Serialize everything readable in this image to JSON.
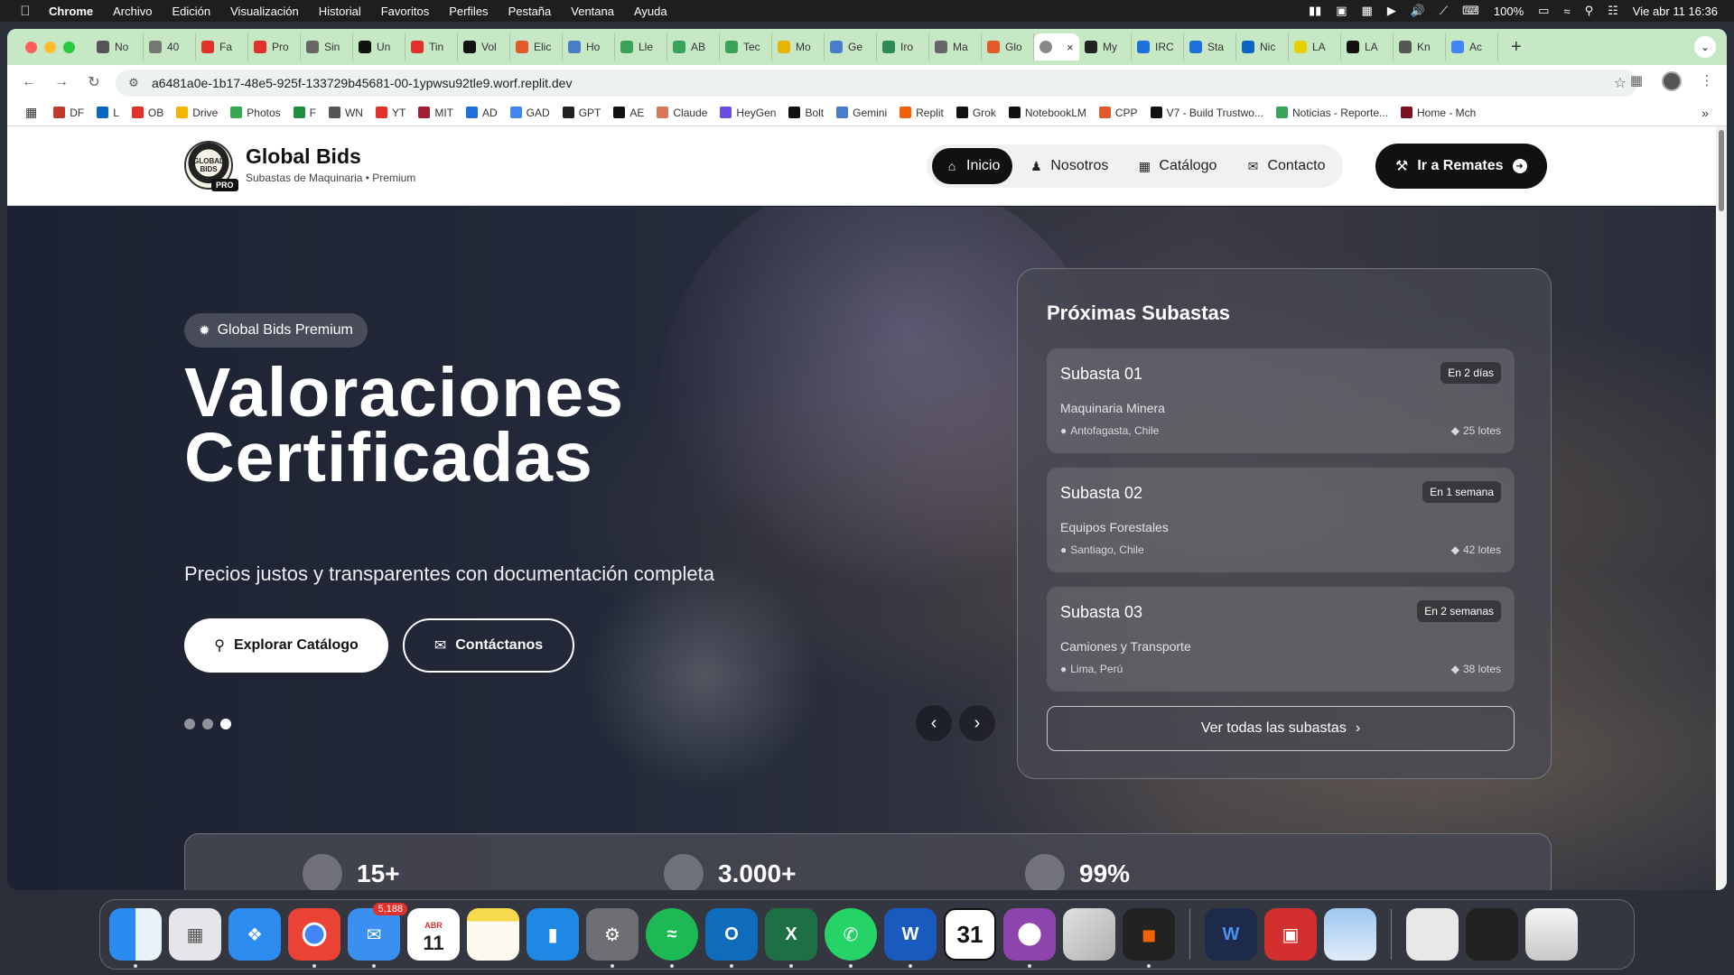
{
  "menubar": {
    "app_name": "Chrome",
    "items": [
      "Archivo",
      "Edición",
      "Visualización",
      "Historial",
      "Favoritos",
      "Perfiles",
      "Pestaña",
      "Ventana",
      "Ayuda"
    ],
    "battery": "100%",
    "datetime": "Vie abr 11  16:36"
  },
  "browser": {
    "tabs": [
      {
        "label": "No",
        "color": "#555"
      },
      {
        "label": "40",
        "color": "#777"
      },
      {
        "label": "Fa",
        "color": "#e0322b"
      },
      {
        "label": "Pro",
        "color": "#e0322b"
      },
      {
        "label": "Sin",
        "color": "#666"
      },
      {
        "label": "Un",
        "color": "#111"
      },
      {
        "label": "Tin",
        "color": "#e0322b"
      },
      {
        "label": "Vol",
        "color": "#111"
      },
      {
        "label": "Elic",
        "color": "#e05a2b"
      },
      {
        "label": "Ho",
        "color": "#4a7dc9"
      },
      {
        "label": "Lle",
        "color": "#3aa35a"
      },
      {
        "label": "AB",
        "color": "#3aa35a"
      },
      {
        "label": "Tec",
        "color": "#3aa35a"
      },
      {
        "label": "Mo",
        "color": "#e6b500"
      },
      {
        "label": "Ge",
        "color": "#4a7dc9"
      },
      {
        "label": "Iro",
        "color": "#2e8b57"
      },
      {
        "label": "Ma",
        "color": "#666"
      },
      {
        "label": "Glo",
        "color": "#e05a2b"
      }
    ],
    "active_tab_close": "×",
    "tabs_after": [
      {
        "label": "My",
        "color": "#222"
      },
      {
        "label": "IRC",
        "color": "#1e6fd9"
      },
      {
        "label": "Sta",
        "color": "#1e6fd9"
      },
      {
        "label": "Nic",
        "color": "#0a66c2"
      },
      {
        "label": "LA",
        "color": "#e6d000"
      },
      {
        "label": "LA",
        "color": "#111"
      },
      {
        "label": "Kn",
        "color": "#555"
      },
      {
        "label": "Ac",
        "color": "#4285f4"
      }
    ],
    "url": "a6481a0e-1b17-48e5-925f-133729b45681-00-1ypwsu92tle9.worf.replit.dev",
    "bookmarks": [
      {
        "label": "DF",
        "color": "#c0392b"
      },
      {
        "label": "L",
        "color": "#0a66c2"
      },
      {
        "label": "OB",
        "color": "#e0322b"
      },
      {
        "label": "Drive",
        "color": "#f4b400"
      },
      {
        "label": "Photos",
        "color": "#34a853"
      },
      {
        "label": "F",
        "color": "#1e8e3e"
      },
      {
        "label": "WN",
        "color": "#555"
      },
      {
        "label": "YT",
        "color": "#e0322b"
      },
      {
        "label": "MIT",
        "color": "#a31f34"
      },
      {
        "label": "AD",
        "color": "#1e6fd9"
      },
      {
        "label": "GAD",
        "color": "#4285f4"
      },
      {
        "label": "GPT",
        "color": "#222"
      },
      {
        "label": "AE",
        "color": "#111"
      },
      {
        "label": "Claude",
        "color": "#d97757"
      },
      {
        "label": "HeyGen",
        "color": "#6b4ce6"
      },
      {
        "label": "Bolt",
        "color": "#111"
      },
      {
        "label": "Gemini",
        "color": "#4a7dc9"
      },
      {
        "label": "Replit",
        "color": "#f26207"
      },
      {
        "label": "Grok",
        "color": "#111"
      },
      {
        "label": "NotebookLM",
        "color": "#111"
      },
      {
        "label": "CPP",
        "color": "#e05a2b"
      },
      {
        "label": "V7 - Build Trustwo...",
        "color": "#111"
      },
      {
        "label": "Noticias - Reporte...",
        "color": "#3aa35a"
      },
      {
        "label": "Home - Mch",
        "color": "#7a1020"
      }
    ]
  },
  "site": {
    "logo_text": "GLOBAL BIDS",
    "logo_badge": "PRO",
    "brand_name": "Global Bids",
    "brand_sub": "Subastas de Maquinaria • Premium",
    "nav": [
      {
        "label": "Inicio",
        "icon": "home-icon"
      },
      {
        "label": "Nosotros",
        "icon": "users-icon"
      },
      {
        "label": "Catálogo",
        "icon": "grid-icon"
      },
      {
        "label": "Contacto",
        "icon": "mail-icon"
      }
    ],
    "cta": "Ir a Remates",
    "hero": {
      "pill": "Global Bids Premium",
      "title_line1": "Valoraciones",
      "title_line2": "Certificadas",
      "subtitle": "Precios justos y transparentes con documentación completa",
      "btn_explore": "Explorar Catálogo",
      "btn_contact": "Contáctanos",
      "active_slide": 3,
      "slide_count": 3
    },
    "panel": {
      "title": "Próximas Subastas",
      "auctions": [
        {
          "name": "Subasta 01",
          "badge": "En 2 días",
          "category": "Maquinaria Minera",
          "location": "Antofagasta, Chile",
          "lots": "25 lotes"
        },
        {
          "name": "Subasta 02",
          "badge": "En 1 semana",
          "category": "Equipos Forestales",
          "location": "Santiago, Chile",
          "lots": "42 lotes"
        },
        {
          "name": "Subasta 03",
          "badge": "En 2 semanas",
          "category": "Camiones y Transporte",
          "location": "Lima, Perú",
          "lots": "38 lotes"
        }
      ],
      "view_all": "Ver todas las subastas"
    },
    "stats": [
      "15+",
      "3.000+",
      "99%"
    ]
  },
  "dock": {
    "mail_badge": "5,188",
    "calendar_month": "ABR",
    "calendar_day": "11",
    "calendar2_day": "31"
  }
}
